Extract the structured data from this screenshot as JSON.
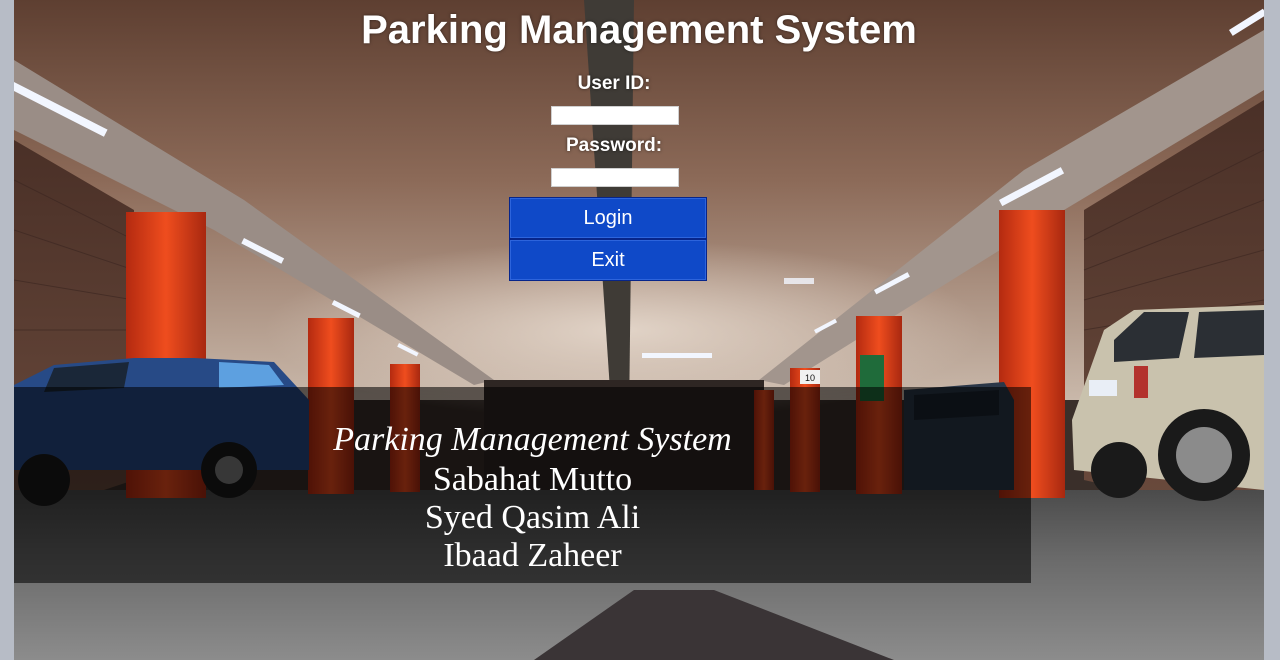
{
  "app": {
    "title": "Parking Management System"
  },
  "login_form": {
    "user_id_label": "User ID:",
    "user_id_value": "",
    "password_label": "Password:",
    "password_value": "",
    "login_button": "Login",
    "exit_button": "Exit",
    "button_color": "#0f49c8"
  },
  "credits": {
    "title": "Parking Management System",
    "members": [
      "Sabahat Mutto",
      "Syed Qasim Ali",
      "Ibaad Zaheer"
    ]
  },
  "background": {
    "sign_number": "10",
    "pillar_color": "#e2421a"
  }
}
